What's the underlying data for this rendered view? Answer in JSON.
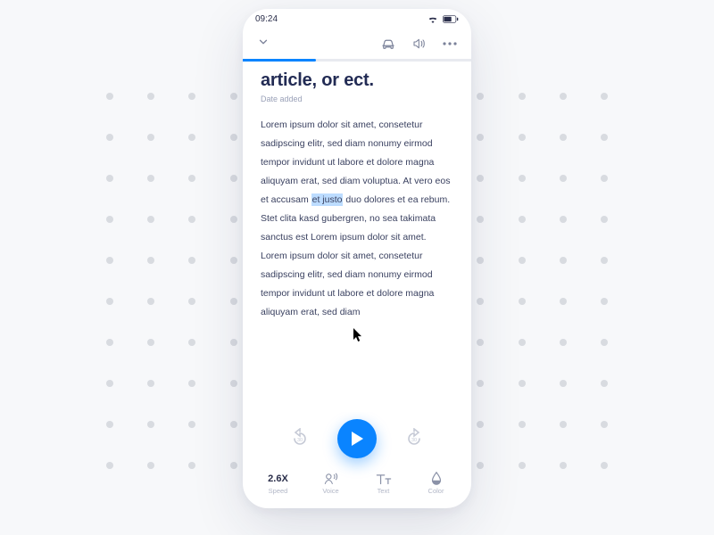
{
  "status": {
    "time": "09:24"
  },
  "article": {
    "title": "article, or ect.",
    "date_label": "Date added",
    "body_pre": "Lorem ipsum dolor sit amet, consetetur sadipscing elitr, sed diam nonumy eirmod tempor invidunt ut labore et dolore magna aliquyam erat, sed diam voluptua. At vero eos et accusam ",
    "body_hl": "et justo",
    "body_post": " duo dolores et ea rebum. Stet clita kasd gubergren, no sea takimata sanctus est Lorem ipsum dolor sit amet. Lorem ipsum dolor sit amet, consetetur sadipscing elitr, sed diam nonumy eirmod tempor invidunt ut labore et dolore magna aliquyam erat, sed diam"
  },
  "progress": {
    "percent": 32
  },
  "player": {
    "rewind_sec": "30",
    "forward_sec": "30"
  },
  "bottom": {
    "speed": {
      "value": "2.6X",
      "label": "Speed"
    },
    "voice": {
      "label": "Voice"
    },
    "text": {
      "label": "Text"
    },
    "color": {
      "label": "Color"
    }
  }
}
